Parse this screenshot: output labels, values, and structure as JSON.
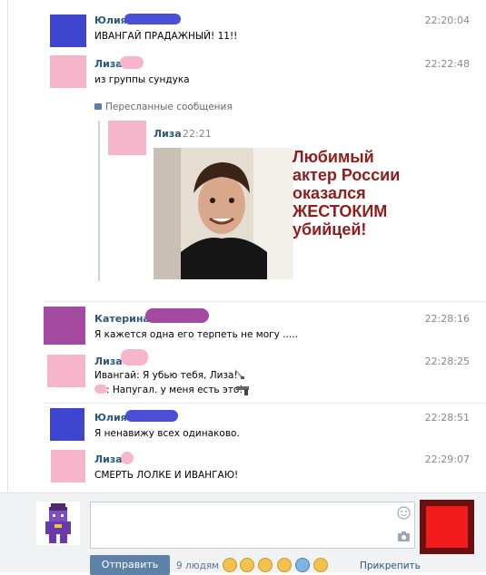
{
  "messages": [
    {
      "name": "Юлия",
      "time": "22:20:04",
      "lines": [
        "ИВАНГАЙ ПРАДАЖНЫЙ! 11!!"
      ]
    },
    {
      "name": "Лиза",
      "time": "22:22:48",
      "lines": [
        "из группы сундука"
      ]
    },
    {
      "name": "Катерина",
      "time": "22:28:16",
      "lines": [
        "Я кажется одна его терпеть не могу ....."
      ]
    },
    {
      "name": "Лиза",
      "time": "22:28:25",
      "lines": [
        "Ивангай: Я убью тебя, Лиза!",
        ": Напугал. у меня есть это!"
      ]
    },
    {
      "name": "Юлия",
      "time": "22:28:51",
      "lines": [
        "Я ненавижу всех одинаково."
      ]
    },
    {
      "name": "Лиза",
      "time": "22:29:07",
      "lines": [
        "СМЕРТЬ ЛОЛКЕ И ИВАНГАЮ!"
      ]
    }
  ],
  "forwarded": {
    "label": "Пересланные сообщения",
    "name": "Лиза",
    "time": "22:21",
    "news_text": "Любимый актер России оказался ЖЕСТОКИМ убийцей!"
  },
  "composer": {
    "send_label": "Отправить",
    "likes_label": "9 людям",
    "attach_label": "Прикрепить"
  },
  "colors": {
    "name_link": "#2b587a",
    "avatar_blue": "#3e45cf",
    "avatar_pink": "#f7b5cc",
    "avatar_purple": "#a44aa0",
    "send_button": "#5e81a8",
    "red_avatar": "#f21b1b"
  }
}
